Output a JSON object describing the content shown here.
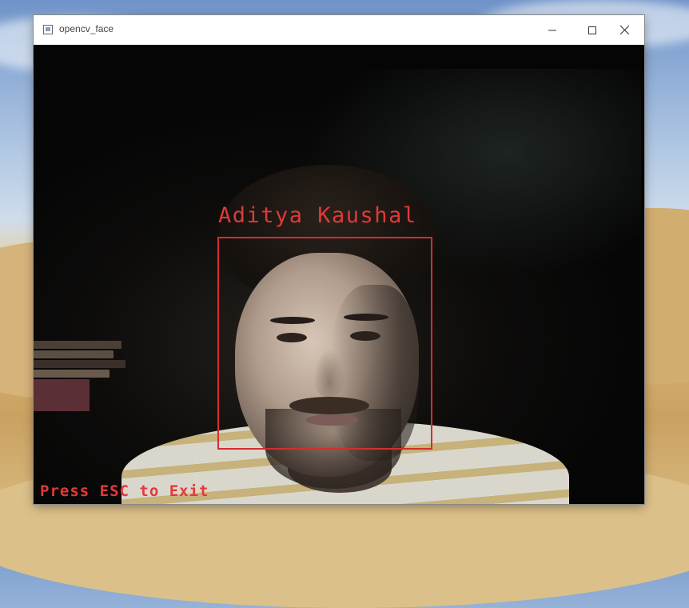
{
  "window": {
    "title": "opencv_face",
    "controls": {
      "minimize_icon": "minimize-icon",
      "maximize_icon": "maximize-icon",
      "close_icon": "close-icon"
    }
  },
  "video": {
    "detection": {
      "label": "Aditya Kaushal",
      "box_color": "#d62d2d"
    },
    "overlay_text": "Press ESC to Exit",
    "overlay_color": "#e03a3a"
  }
}
